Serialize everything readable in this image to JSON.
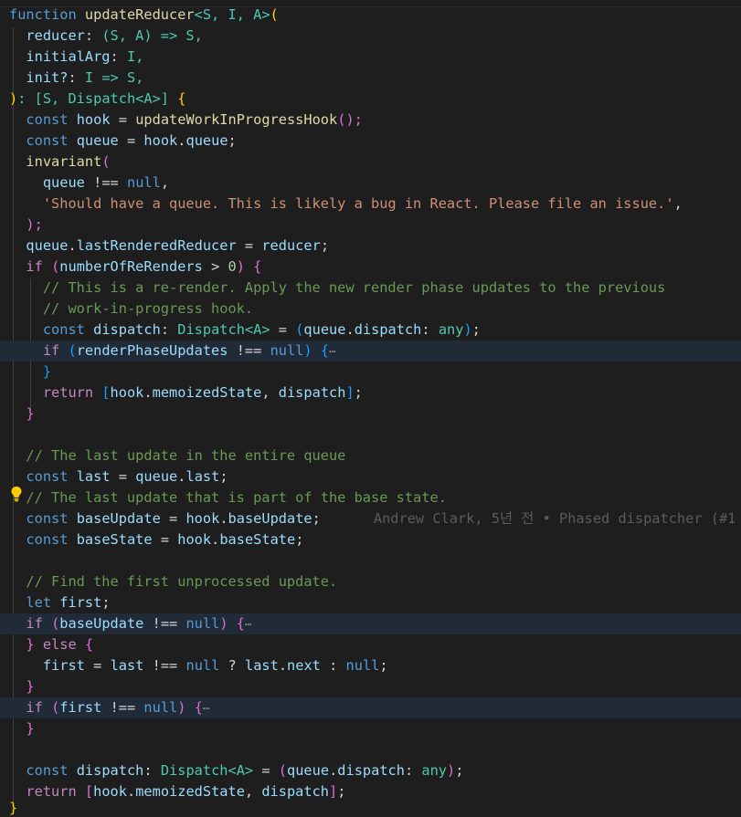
{
  "code": {
    "l1": {
      "kw": "function",
      "name": "updateReducer",
      "generics": "<S, I, A>",
      "open": "("
    },
    "l2": {
      "param": "reducer",
      "type": "(S, A) => S,"
    },
    "l3": {
      "param": "initialArg",
      "type": "I,"
    },
    "l4": {
      "param": "init?",
      "type": "I => S,"
    },
    "l5": {
      "close": ")",
      "ret": ": [S, Dispatch<A>]",
      "brace": "{"
    },
    "l6": {
      "kw": "const",
      "name": "hook",
      "eq": "=",
      "call": "updateWorkInProgressHook",
      "tail": "();"
    },
    "l7": {
      "kw": "const",
      "name": "queue",
      "eq": "=",
      "expr1": "hook",
      "expr2": "queue",
      "tail": ";"
    },
    "l8": {
      "call": "invariant",
      "open": "("
    },
    "l9": {
      "name": "queue",
      "op": "!==",
      "val": "null",
      "tail": ","
    },
    "l10": {
      "str": "'Should have a queue. This is likely a bug in React. Please file an issue.'",
      "tail": ","
    },
    "l11": {
      "close": ");"
    },
    "l12": {
      "obj": "queue",
      "prop": "lastRenderedReducer",
      "eq": "=",
      "val": "reducer",
      "tail": ";"
    },
    "l13": {
      "kw": "if",
      "open": "(",
      "name": "numberOfReRenders",
      "op": ">",
      "num": "0",
      "close": ")",
      "brace": "{"
    },
    "l14": {
      "comment": "// This is a re-render. Apply the new render phase updates to the previous"
    },
    "l15": {
      "comment": "// work-in-progress hook."
    },
    "l16": {
      "kw": "const",
      "name": "dispatch",
      "type": "Dispatch<A>",
      "eq": "=",
      "obj": "queue",
      "prop": "dispatch",
      "cast": "any",
      "tail": ";"
    },
    "l17": {
      "kw": "if",
      "name": "renderPhaseUpdates",
      "op": "!==",
      "val": "null",
      "brace": "{",
      "fold": "⋯"
    },
    "l18": {
      "brace": "}"
    },
    "l19": {
      "kw": "return",
      "obj": "hook",
      "prop": "memoizedState",
      "name": "dispatch",
      "tail": ";"
    },
    "l20": {
      "brace": "}"
    },
    "l22": {
      "comment": "// The last update in the entire queue"
    },
    "l23": {
      "kw": "const",
      "name": "last",
      "eq": "=",
      "obj": "queue",
      "prop": "last",
      "tail": ";"
    },
    "l24": {
      "comment": "// The last update that is part of the base state."
    },
    "l25": {
      "kw": "const",
      "name": "baseUpdate",
      "eq": "=",
      "obj": "hook",
      "prop": "baseUpdate",
      "tail": ";",
      "blame": "Andrew Clark, 5년 전 • Phased dispatcher (#1"
    },
    "l26": {
      "kw": "const",
      "name": "baseState",
      "eq": "=",
      "obj": "hook",
      "prop": "baseState",
      "tail": ";"
    },
    "l28": {
      "comment": "// Find the first unprocessed update."
    },
    "l29": {
      "kw": "let",
      "name": "first",
      "tail": ";"
    },
    "l30": {
      "kw": "if",
      "name": "baseUpdate",
      "op": "!==",
      "val": "null",
      "brace": "{",
      "fold": "⋯"
    },
    "l31": {
      "close": "}",
      "kw": "else",
      "brace": "{"
    },
    "l32": {
      "name": "first",
      "eq": "=",
      "obj": "last",
      "op": "!==",
      "val": "null",
      "q": "?",
      "obj2": "last",
      "prop": "next",
      "colon": ":",
      "val2": "null",
      "tail": ";"
    },
    "l33": {
      "brace": "}"
    },
    "l34": {
      "kw": "if",
      "name": "first",
      "op": "!==",
      "val": "null",
      "brace": "{",
      "fold": "⋯"
    },
    "l35": {
      "brace": "}"
    },
    "l37": {
      "kw": "const",
      "name": "dispatch",
      "type": "Dispatch<A>",
      "eq": "=",
      "obj": "queue",
      "prop": "dispatch",
      "cast": "any",
      "tail": ";"
    },
    "l38": {
      "kw": "return",
      "obj": "hook",
      "prop": "memoizedState",
      "name": "dispatch",
      "tail": ";"
    },
    "l39": {
      "brace": "}"
    }
  },
  "icons": {
    "lightbulb": "lightbulb-icon"
  },
  "colors": {
    "background": "#1e1e1e",
    "highlight": "#212a37",
    "keyword": "#569cd6"
  }
}
